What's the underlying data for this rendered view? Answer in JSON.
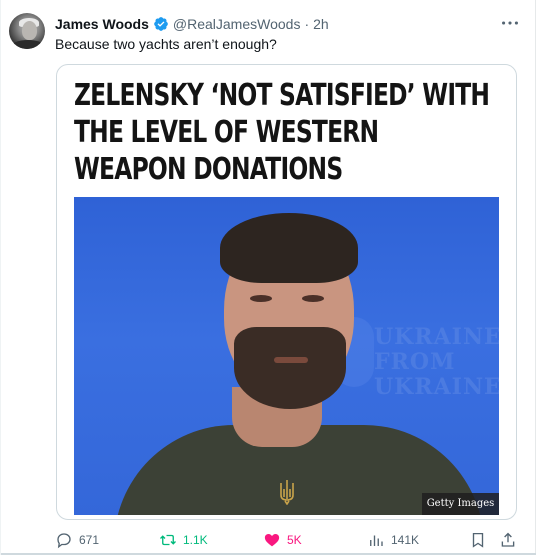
{
  "tweet": {
    "author_name": "James Woods",
    "handle": "@RealJamesWoods",
    "separator": "·",
    "time": "2h",
    "text": "Because two yachts aren’t enough?"
  },
  "media": {
    "headline_lines": [
      "ZELENSKY ‘NOT SATISFIED’ WITH",
      "THE LEVEL OF WESTERN",
      "WEAPON DONATIONS"
    ],
    "background_text": [
      "UKRAINE",
      "FROM",
      "UKRAINE"
    ],
    "photo_credit": "Getty Images"
  },
  "actions": {
    "replies": "671",
    "retweets": "1.1K",
    "likes": "5K",
    "views": "141K"
  },
  "colors": {
    "verified": "#1d9bf0",
    "retweet_active": "#00ba7c",
    "like_active": "#f91880",
    "secondary_text": "#536471"
  },
  "icons": [
    "verified-badge-icon",
    "more-icon",
    "reply-icon",
    "retweet-icon",
    "heart-icon",
    "views-icon",
    "bookmark-icon",
    "share-icon"
  ]
}
